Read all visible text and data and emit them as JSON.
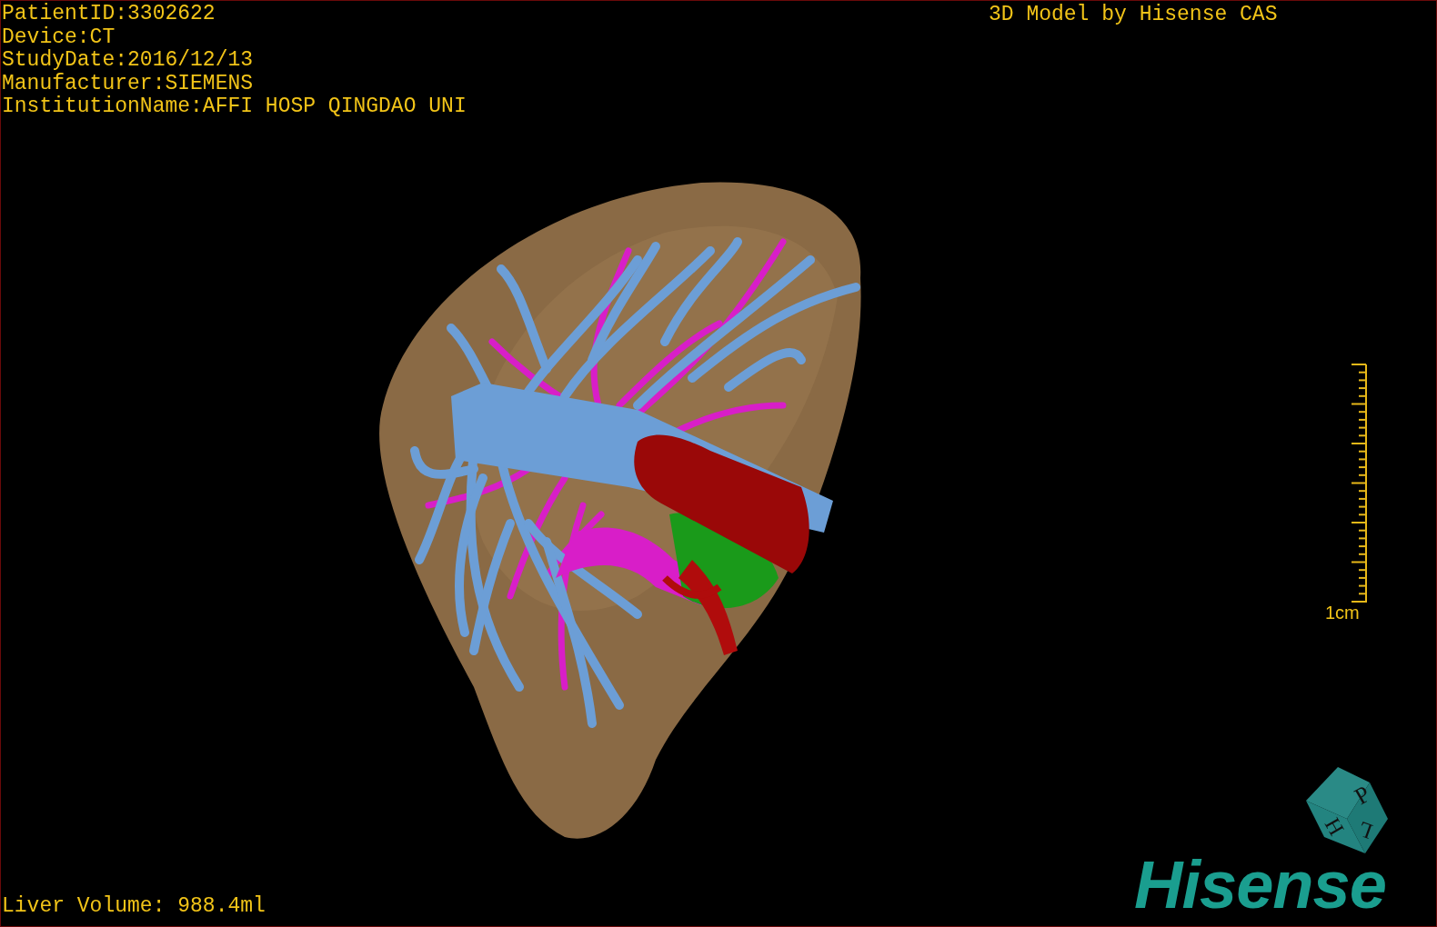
{
  "viewport": {
    "info_lines": [
      "PatientID:3302622",
      "Device:CT",
      "StudyDate:2016/12/13",
      "Manufacturer:SIEMENS",
      "InstitutionName:AFFI HOSP QINGDAO UNI"
    ],
    "title": "3D Model by Hisense CAS",
    "scale_label": "1cm",
    "liver_volume": "Liver Volume: 988.4ml",
    "orientation_cube": {
      "faces": [
        "P",
        "H",
        "L"
      ]
    },
    "logo": "Hisense"
  }
}
